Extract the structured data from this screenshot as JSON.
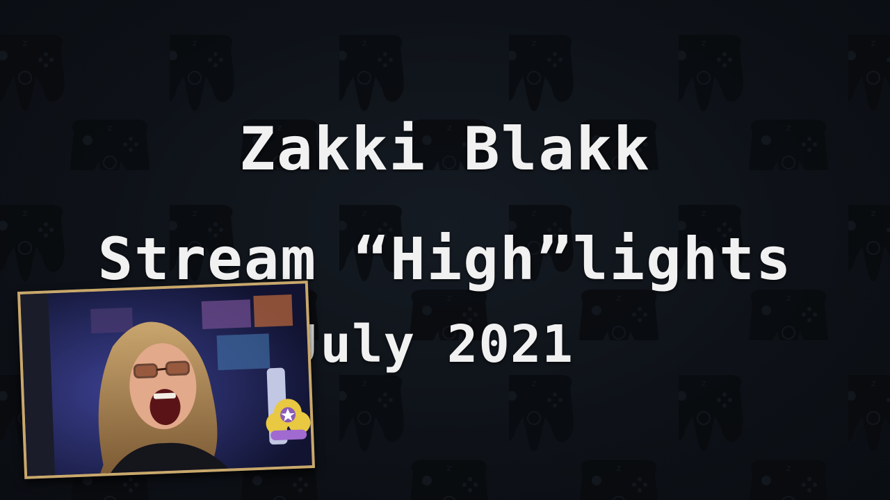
{
  "title": {
    "line1": "Zakki Blakk",
    "line2": "Stream “High”lights",
    "line3": "July 2021"
  },
  "background": {
    "pattern_icon": "n64-controller-icon",
    "color": "#0e1218"
  },
  "webcam": {
    "border_color": "#c9a86b",
    "badge_icon": "star-cloud-icon"
  }
}
